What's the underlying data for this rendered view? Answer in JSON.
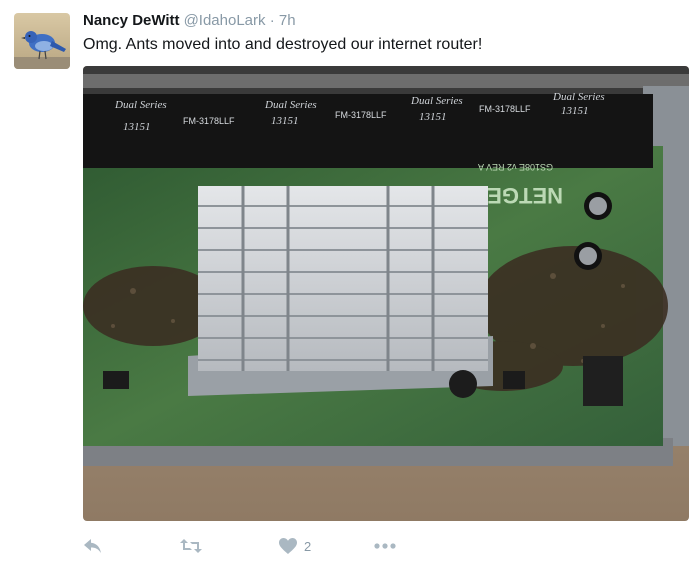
{
  "tweet": {
    "author_name": "Nancy DeWitt",
    "handle": "@IdahoLark",
    "separator": "·",
    "time": "7h",
    "text": "Omg. Ants moved into and destroyed our internet router!",
    "media": {
      "icon": "photo",
      "printed_text": {
        "chip_brand": "Dual Series",
        "chip_code": "13151",
        "chip_part": "FM-3178LLF",
        "board_brand": "NETGEAR",
        "board_serial": "GS108E v2 REV A"
      }
    },
    "actions": {
      "reply_icon": "reply-icon",
      "retweet_icon": "retweet-icon",
      "like_icon": "heart-icon",
      "like_count": "2",
      "more_icon": "more-icon"
    }
  },
  "colors": {
    "text": "#14171a",
    "secondary": "#8899a6",
    "icon": "#aab8c2",
    "board_green": "#3f6a3a",
    "heatsink": "#c9ccd0"
  }
}
